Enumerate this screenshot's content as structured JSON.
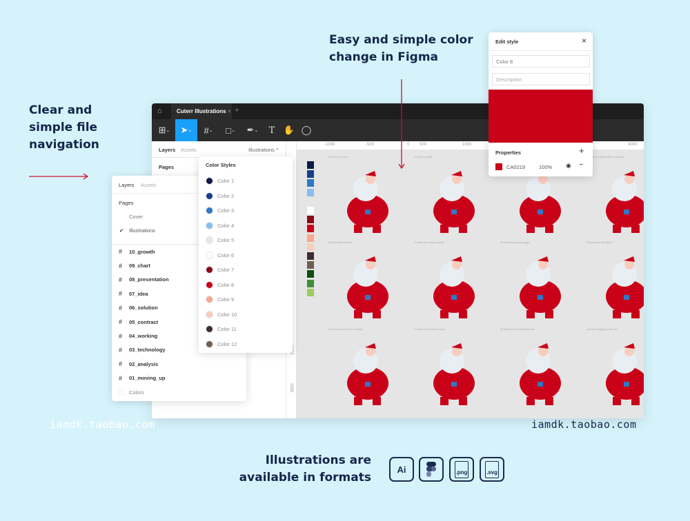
{
  "headlines": {
    "color_change": [
      "Easy and simple color",
      "change in Figma"
    ],
    "navigation": [
      "Clear and",
      "simple file",
      "navigation"
    ],
    "formats": [
      "Illustrations are",
      "available in formats"
    ]
  },
  "formats": [
    {
      "label": "Ai",
      "icon": "adobe-illustrator-icon"
    },
    {
      "label": "",
      "icon": "figma-icon"
    },
    {
      "label": ".png",
      "icon": "png-file-icon"
    },
    {
      "label": ".svg",
      "icon": "svg-file-icon"
    }
  ],
  "watermark": "iamdk.taobao.com",
  "accent_color": "#c8102e",
  "figma": {
    "tab_title": "Cuterr Illustrations",
    "panel_tabs": {
      "layers": "Layers",
      "assets": "Assets",
      "page_selector": "Illustrations ^"
    },
    "pages_label": "Pages",
    "ruler_x": [
      "-1000",
      "-500",
      "0",
      "500",
      "1000",
      "1500",
      "4000",
      "45"
    ],
    "ruler_y": [
      "2500",
      "3000"
    ]
  },
  "layers_panel": {
    "tabs": [
      "Layers",
      "Assets"
    ],
    "pages_label": "Pages",
    "pages": [
      {
        "name": "Cover",
        "checked": false
      },
      {
        "name": "Illustrations",
        "checked": true
      }
    ],
    "frames": [
      "10_growth",
      "09_chart",
      "08_presentation",
      "07_idea",
      "06_solution",
      "05_contract",
      "04_working",
      "03_technology",
      "02_analysis",
      "01_moving_up"
    ],
    "colors_item": "Colors"
  },
  "color_styles": {
    "title": "Color Styles",
    "items": [
      {
        "name": "Color 1",
        "hex": "#0e1a4a"
      },
      {
        "name": "Color 2",
        "hex": "#143f8c"
      },
      {
        "name": "Color 3",
        "hex": "#2f78c8"
      },
      {
        "name": "Color 4",
        "hex": "#86bdf0"
      },
      {
        "name": "Color 5",
        "hex": "#e1e8ef"
      },
      {
        "name": "Color 6",
        "hex": "#ffffff"
      },
      {
        "name": "Color 7",
        "hex": "#8a0a16"
      },
      {
        "name": "Color 8",
        "hex": "#ca0219"
      },
      {
        "name": "Color 9",
        "hex": "#f7a88d"
      },
      {
        "name": "Color 10",
        "hex": "#f8cdbd"
      },
      {
        "name": "Color 11",
        "hex": "#3e2d33"
      },
      {
        "name": "Color 12",
        "hex": "#6e5f54"
      }
    ]
  },
  "edit_style": {
    "title": "Edit style",
    "name_value": "Color 8",
    "description_placeholder": "Description",
    "preview_color": "#ca0219",
    "properties_label": "Properties",
    "hex": "CA0219",
    "opacity": "100%"
  },
  "canvas_swatches": [
    "#0e1a4a",
    "#143f8c",
    "#2f78c8",
    "#86bdf0",
    "",
    "#ffffff",
    "#8a0a16",
    "#ca0219",
    "#f7a88d",
    "#f8cdbd",
    "#3e2d33",
    "#6e5f54",
    "#0f4d12",
    "#3f8f3a",
    "#9ccc5f"
  ],
  "canvas_frames": [
    "01 Santa in a chair",
    "02 Santa and gift",
    "03 Santa",
    "04 Santa is played with a snowball",
    "05 Santa rides a horse",
    "07 santa and a bag of treats",
    "08 Santa and gnome juggle",
    "09 santa and toy lollipop",
    "11 santa and gnome on a spring",
    "12 Santa and christmas sock",
    "13 Santa and decorates the tree",
    "14 Santa hanging on the tree"
  ]
}
